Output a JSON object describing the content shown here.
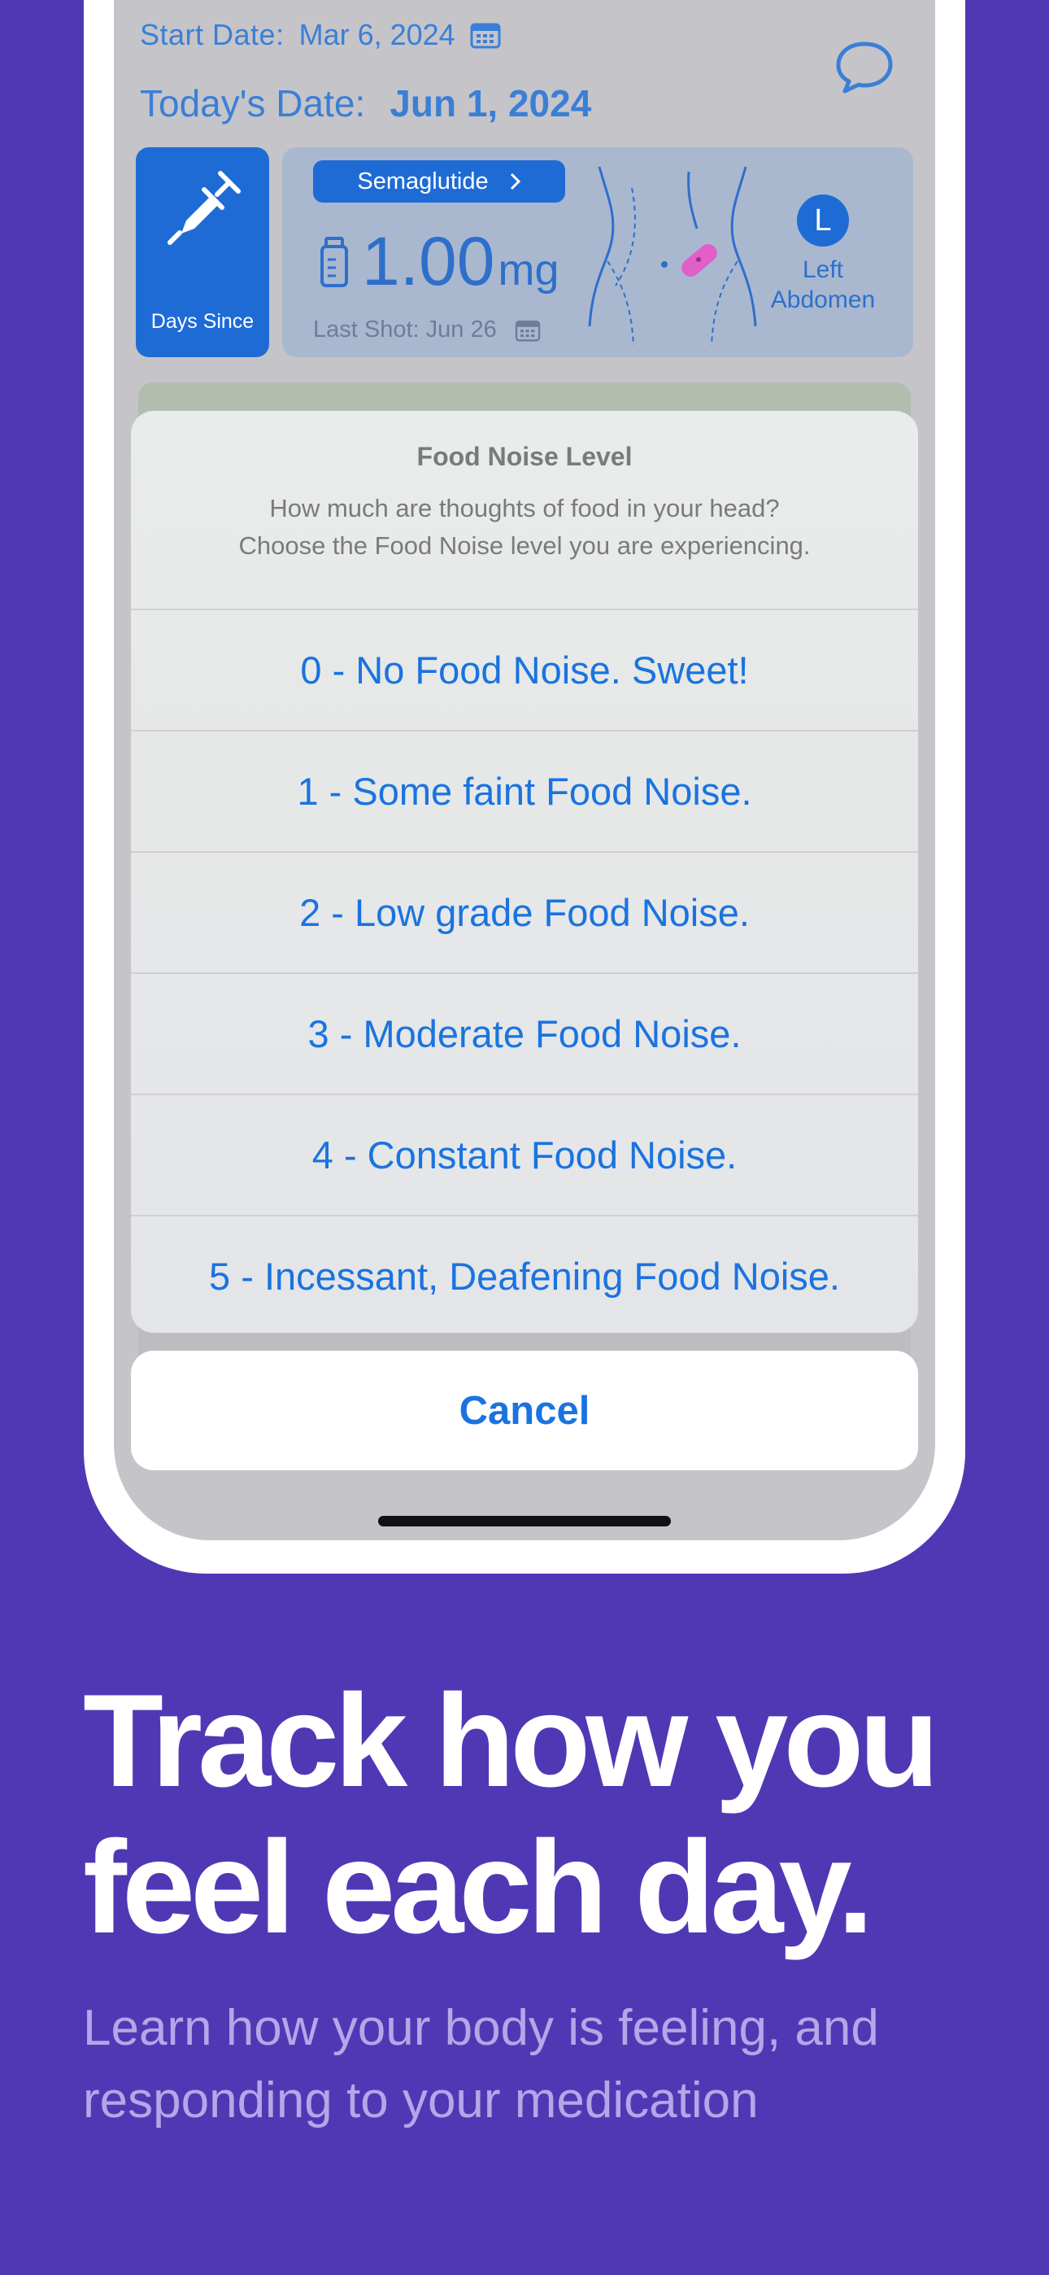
{
  "header": {
    "start_label": "Start Date:",
    "start_value": "Mar 6, 2024",
    "today_label": "Today's Date:",
    "today_value": "Jun 1, 2024"
  },
  "days_card": {
    "label": "Days Since"
  },
  "medication": {
    "name": "Semaglutide",
    "dose_value": "1.00",
    "dose_unit": "mg",
    "last_shot": "Last Shot: Jun 26",
    "site_badge": "L",
    "site_line1": "Left",
    "site_line2": "Abdomen"
  },
  "action_sheet": {
    "title": "Food Noise Level",
    "message_line1": "How much are thoughts of food in your head?",
    "message_line2": "Choose the Food Noise level you are experiencing.",
    "options": [
      "0 - No Food Noise. Sweet!",
      "1 - Some faint Food Noise.",
      "2 - Low grade Food Noise.",
      "3 - Moderate Food Noise.",
      "4 - Constant Food Noise.",
      "5 - Incessant, Deafening Food Noise."
    ],
    "cancel": "Cancel"
  },
  "marketing": {
    "headline_line1": "Track how you",
    "headline_line2": "feel each day.",
    "sub_line1": "Learn how your body is feeling, and",
    "sub_line2": "responding to your medication"
  },
  "colors": {
    "background": "#5038B5",
    "accent": "#1A73E0"
  }
}
